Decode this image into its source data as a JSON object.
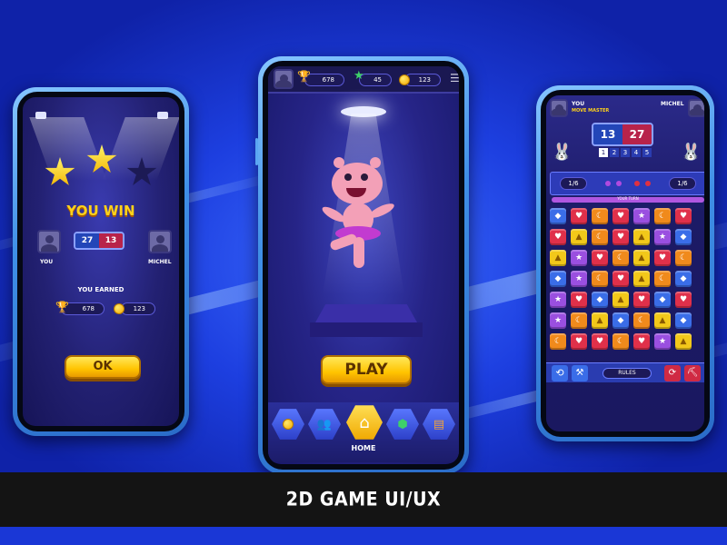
{
  "footer": {
    "title": "2D GAME UI/UX"
  },
  "win_screen": {
    "title": "YOU WIN",
    "player_left": "YOU",
    "player_right": "MICHEL",
    "score_left": "27",
    "score_right": "13",
    "earned_label": "YOU EARNED",
    "trophies": "678",
    "coins": "123",
    "ok_label": "OK",
    "stars_earned": 2,
    "stars_total": 3
  },
  "home_screen": {
    "trophies": "678",
    "stars": "45",
    "coins": "123",
    "play_label": "PLAY",
    "nav_items": [
      {
        "icon": "coins-icon"
      },
      {
        "icon": "friends-icon"
      },
      {
        "icon": "home-icon",
        "label": "HOME",
        "active": true
      },
      {
        "icon": "badge-icon"
      },
      {
        "icon": "book-icon"
      }
    ]
  },
  "match_screen": {
    "player_left": "YOU",
    "player_left_sub": "MOVE MASTER",
    "player_right": "MICHEL",
    "score_left": "13",
    "score_right": "27",
    "rounds": [
      "1",
      "2",
      "3",
      "4",
      "5"
    ],
    "moves_left": "1/6",
    "moves_right": "1/6",
    "turn_label": "YOUR TURN",
    "rules_label": "RULES",
    "board": [
      [
        "blue",
        "red",
        "orange",
        "red",
        "purple",
        "orange",
        "red"
      ],
      [
        "red",
        "yellow",
        "orange",
        "red",
        "yellow",
        "purple",
        "blue"
      ],
      [
        "yellow",
        "purple",
        "red",
        "orange",
        "yellow",
        "red",
        "orange"
      ],
      [
        "blue",
        "purple",
        "orange",
        "red",
        "yellow",
        "orange",
        "blue"
      ],
      [
        "purple",
        "red",
        "blue",
        "yellow",
        "red",
        "blue",
        "red"
      ],
      [
        "purple",
        "orange",
        "yellow",
        "blue",
        "orange",
        "yellow",
        "blue"
      ],
      [
        "orange",
        "red",
        "red",
        "orange",
        "red",
        "purple",
        "yellow"
      ]
    ]
  },
  "tile_symbols": {
    "red": "♥",
    "purple": "★",
    "orange": "☾",
    "yellow": "▲",
    "blue": "◆"
  }
}
